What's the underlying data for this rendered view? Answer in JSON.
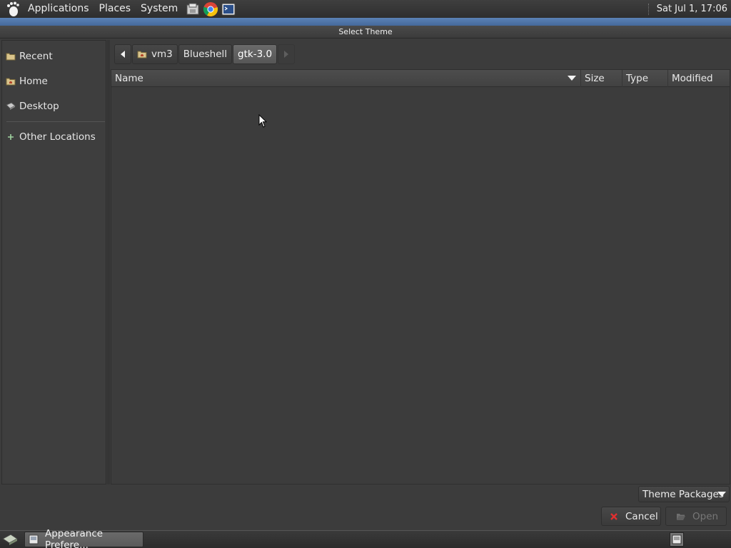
{
  "top_panel": {
    "menus": [
      "Applications",
      "Places",
      "System"
    ],
    "launchers": [
      "file-manager-icon",
      "chrome-icon",
      "terminal-icon"
    ],
    "clock": "Sat Jul  1, 17:06"
  },
  "window": {
    "title": "Select Theme"
  },
  "sidebar": {
    "items": [
      {
        "label": "Recent",
        "icon": "recent-folder-icon"
      },
      {
        "label": "Home",
        "icon": "home-folder-icon"
      },
      {
        "label": "Desktop",
        "icon": "desktop-icon"
      },
      {
        "label": "Other Locations",
        "icon": "plus-icon"
      }
    ]
  },
  "pathbar": {
    "crumbs": [
      "vm3",
      "Blueshell",
      "gtk-3.0"
    ],
    "active": "gtk-3.0"
  },
  "file_list": {
    "columns": [
      "Name",
      "Size",
      "Type",
      "Modified"
    ],
    "rows": []
  },
  "footer": {
    "filter": "Theme Packages",
    "cancel_label": "Cancel",
    "open_label": "Open"
  },
  "taskbar": {
    "tasks": [
      "Appearance Prefere..."
    ]
  },
  "colors": {
    "title_accent": "#5b82b6",
    "background": "#3c3c3c"
  }
}
